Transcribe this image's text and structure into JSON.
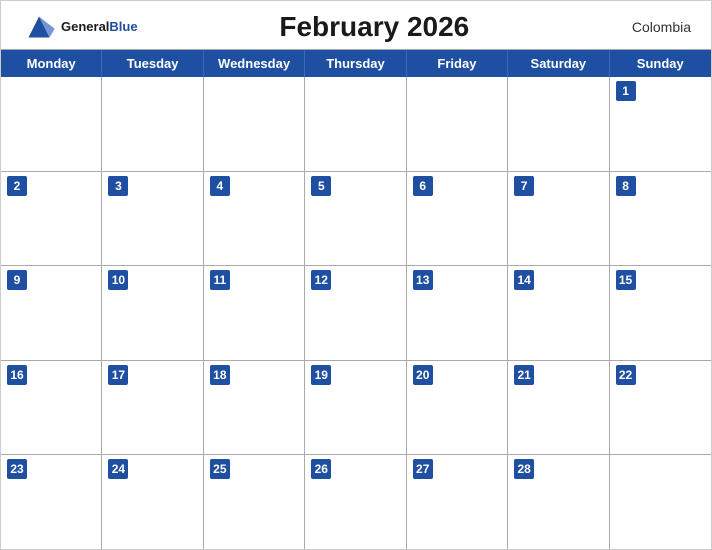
{
  "header": {
    "logo_general": "General",
    "logo_blue": "Blue",
    "month_title": "February 2026",
    "country": "Colombia"
  },
  "days_of_week": [
    "Monday",
    "Tuesday",
    "Wednesday",
    "Thursday",
    "Friday",
    "Saturday",
    "Sunday"
  ],
  "weeks": [
    [
      {
        "day": "",
        "empty": true
      },
      {
        "day": "",
        "empty": true
      },
      {
        "day": "",
        "empty": true
      },
      {
        "day": "",
        "empty": true
      },
      {
        "day": "",
        "empty": true
      },
      {
        "day": "",
        "empty": true
      },
      {
        "day": "1",
        "empty": false
      }
    ],
    [
      {
        "day": "2",
        "empty": false
      },
      {
        "day": "3",
        "empty": false
      },
      {
        "day": "4",
        "empty": false
      },
      {
        "day": "5",
        "empty": false
      },
      {
        "day": "6",
        "empty": false
      },
      {
        "day": "7",
        "empty": false
      },
      {
        "day": "8",
        "empty": false
      }
    ],
    [
      {
        "day": "9",
        "empty": false
      },
      {
        "day": "10",
        "empty": false
      },
      {
        "day": "11",
        "empty": false
      },
      {
        "day": "12",
        "empty": false
      },
      {
        "day": "13",
        "empty": false
      },
      {
        "day": "14",
        "empty": false
      },
      {
        "day": "15",
        "empty": false
      }
    ],
    [
      {
        "day": "16",
        "empty": false
      },
      {
        "day": "17",
        "empty": false
      },
      {
        "day": "18",
        "empty": false
      },
      {
        "day": "19",
        "empty": false
      },
      {
        "day": "20",
        "empty": false
      },
      {
        "day": "21",
        "empty": false
      },
      {
        "day": "22",
        "empty": false
      }
    ],
    [
      {
        "day": "23",
        "empty": false
      },
      {
        "day": "24",
        "empty": false
      },
      {
        "day": "25",
        "empty": false
      },
      {
        "day": "26",
        "empty": false
      },
      {
        "day": "27",
        "empty": false
      },
      {
        "day": "28",
        "empty": false
      },
      {
        "day": "",
        "empty": true
      }
    ]
  ]
}
